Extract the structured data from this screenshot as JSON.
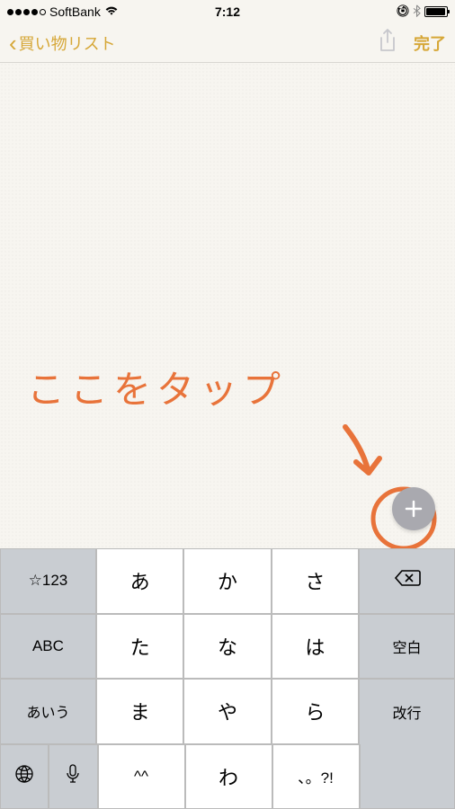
{
  "status": {
    "carrier": "SoftBank",
    "time": "7:12"
  },
  "nav": {
    "back_label": "買い物リスト",
    "done_label": "完了"
  },
  "annotation": {
    "text": "ここをタップ"
  },
  "keyboard": {
    "row1": {
      "left": "☆123",
      "k1": "あ",
      "k2": "か",
      "k3": "さ",
      "right_icon": "backspace"
    },
    "row2": {
      "left": "ABC",
      "k1": "た",
      "k2": "な",
      "k3": "は",
      "right": "空白"
    },
    "row3": {
      "left": "あいう",
      "k1": "ま",
      "k2": "や",
      "k3": "ら"
    },
    "row4": {
      "k1": "^^",
      "k2": "わ",
      "k3": "、。?!",
      "right": "改行"
    },
    "globe": "globe-icon",
    "mic": "mic-icon"
  },
  "colors": {
    "accent": "#d6a737",
    "annotation": "#e8733a"
  }
}
